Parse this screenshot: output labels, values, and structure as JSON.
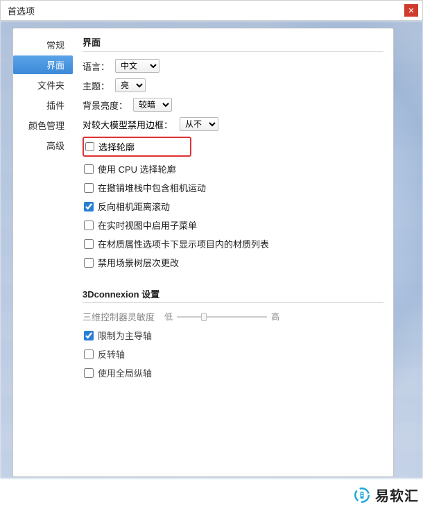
{
  "titlebar": {
    "title": "首选项",
    "close_icon": "✕"
  },
  "sidebar": {
    "items": [
      {
        "label": "常规"
      },
      {
        "label": "界面"
      },
      {
        "label": "文件夹"
      },
      {
        "label": "插件"
      },
      {
        "label": "颜色管理"
      },
      {
        "label": "高级"
      }
    ],
    "selected_index": 1
  },
  "main": {
    "section1_title": "界面",
    "language_label": "语言：",
    "language_value": "中文",
    "theme_label": "主题：",
    "theme_value": "亮",
    "bg_brightness_label": "背景亮度：",
    "bg_brightness_value": "较暗",
    "large_model_label": "对较大模型禁用边框：",
    "large_model_value": "从不",
    "checks": [
      {
        "label": "选择轮廓",
        "checked": false,
        "highlight": true
      },
      {
        "label": "使用 CPU 选择轮廓",
        "checked": false
      },
      {
        "label": "在撤销堆栈中包含相机运动",
        "checked": false
      },
      {
        "label": "反向相机距离滚动",
        "checked": true
      },
      {
        "label": "在实时视图中启用子菜单",
        "checked": false
      },
      {
        "label": "在材质属性选项卡下显示项目内的材质列表",
        "checked": false
      },
      {
        "label": "禁用场景树层次更改",
        "checked": false
      }
    ],
    "section2_title": "3Dconnexion 设置",
    "sensitivity_label": "三维控制器灵敏度",
    "sensitivity_low": "低",
    "sensitivity_high": "高",
    "section2_checks": [
      {
        "label": "限制为主导轴",
        "checked": true
      },
      {
        "label": "反转轴",
        "checked": false
      },
      {
        "label": "使用全局纵轴",
        "checked": false
      }
    ]
  },
  "watermark": {
    "text": "易软汇"
  }
}
